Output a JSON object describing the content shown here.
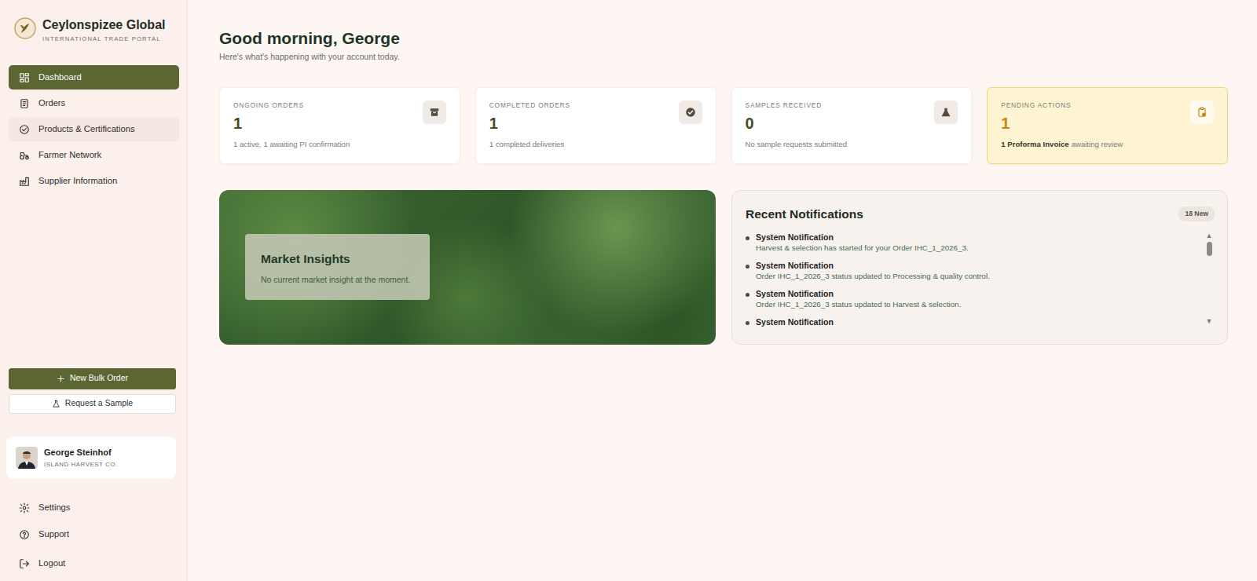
{
  "brand": {
    "name": "Ceylonspizee Global",
    "tagline": "INTERNATIONAL TRADE PORTAL"
  },
  "sidebar": {
    "items": [
      {
        "label": "Dashboard",
        "selected": true,
        "hovered": false
      },
      {
        "label": "Orders",
        "selected": false,
        "hovered": false
      },
      {
        "label": "Products & Certifications",
        "selected": false,
        "hovered": true
      },
      {
        "label": "Farmer Network",
        "selected": false,
        "hovered": false
      },
      {
        "label": "Supplier Information",
        "selected": false,
        "hovered": false
      }
    ],
    "actions": [
      {
        "label": "New Bulk Order",
        "kind": "primary"
      },
      {
        "label": "Request a Sample",
        "kind": "outline"
      }
    ],
    "user": {
      "name": "George Steinhof",
      "company": "ISLAND HARVEST CO."
    },
    "footer": [
      {
        "label": "Settings"
      },
      {
        "label": "Support"
      },
      {
        "label": "Logout"
      }
    ]
  },
  "greeting": {
    "title": "Good morning, George",
    "subtitle": "Here's what's happening with your account today."
  },
  "stats": [
    {
      "label": "ONGOING ORDERS",
      "value": "1",
      "note": [
        {
          "text": "1 active, 1 awaiting PI confirmation",
          "bold": false
        }
      ],
      "highlighted": false
    },
    {
      "label": "COMPLETED ORDERS",
      "value": "1",
      "note": [
        {
          "text": "1 completed deliveries",
          "bold": false
        }
      ],
      "highlighted": false
    },
    {
      "label": "SAMPLES RECEIVED",
      "value": "0",
      "note": [
        {
          "text": "No sample requests submitted",
          "bold": false
        }
      ],
      "highlighted": false
    },
    {
      "label": "PENDING ACTIONS",
      "value": "1",
      "note": [
        {
          "text": "1 Proforma Invoice",
          "bold": true
        },
        {
          "text": "awaiting review",
          "bold": false
        }
      ],
      "highlighted": true
    }
  ],
  "insights": {
    "title": "Market Insights",
    "text": "No current market insight at the moment."
  },
  "notifications": {
    "title": "Recent Notifications",
    "badge": "18 New",
    "items": [
      {
        "title": "System Notification",
        "text": "Harvest & selection has started for your Order IHC_1_2026_3."
      },
      {
        "title": "System Notification",
        "text": "Order IHC_1_2026_3 status updated to Processing & quality control."
      },
      {
        "title": "System Notification",
        "text": "Order IHC_1_2026_3 status updated to Harvest & selection."
      },
      {
        "title": "System Notification"
      }
    ],
    "scroll_up": "▲",
    "scroll_down": "▼"
  }
}
